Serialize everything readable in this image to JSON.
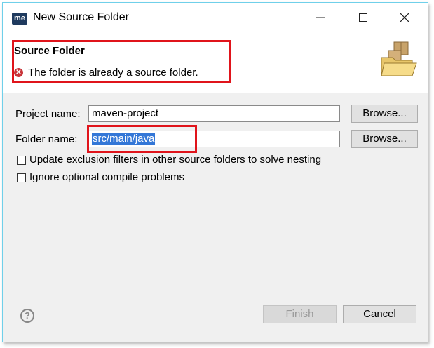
{
  "window": {
    "app_icon_text": "me",
    "title": "New Source Folder",
    "minimize_icon": "minimize-icon",
    "maximize_icon": "maximize-icon",
    "close_icon": "close-icon"
  },
  "banner": {
    "title": "Source Folder",
    "error_icon": "error-icon",
    "message": "The folder is already a source folder.",
    "wizard_icon": "folder-package-icon"
  },
  "form": {
    "project_label": "Project name:",
    "project_value": "maven-project",
    "project_browse": "Browse...",
    "folder_label": "Folder name:",
    "folder_value": "src/main/java",
    "folder_browse": "Browse...",
    "options": [
      {
        "label": "Update exclusion filters in other source folders to solve nesting",
        "checked": false
      },
      {
        "label": "Ignore optional compile problems",
        "checked": false
      }
    ]
  },
  "footer": {
    "help_icon": "help-icon",
    "finish_label": "Finish",
    "cancel_label": "Cancel"
  },
  "colors": {
    "error": "#c8353a",
    "highlight_box": "#e0141b",
    "selection": "#3377d7"
  }
}
